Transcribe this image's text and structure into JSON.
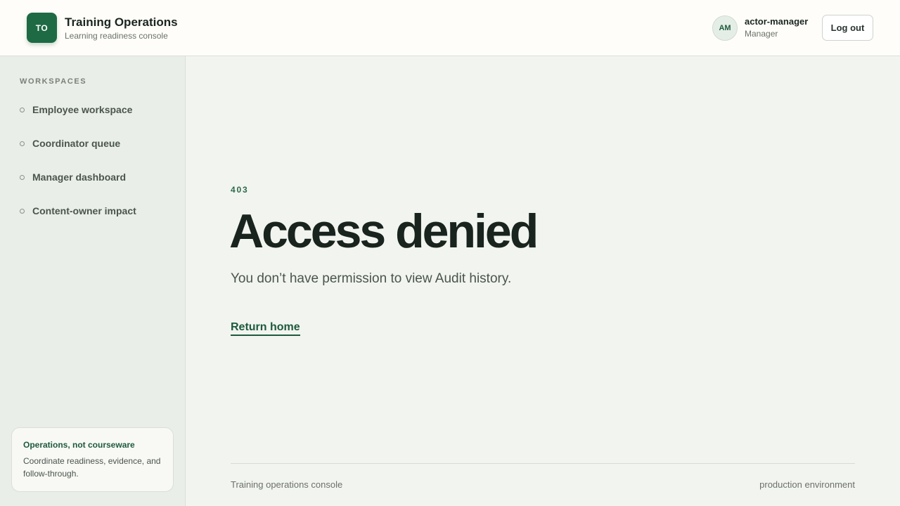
{
  "header": {
    "brand_initials": "TO",
    "brand_title": "Training Operations",
    "brand_subtitle": "Learning readiness console",
    "user_initials": "AM",
    "user_name": "actor-manager",
    "user_role": "Manager",
    "logout_label": "Log out"
  },
  "sidebar": {
    "heading": "WORKSPACES",
    "items": [
      {
        "label": "Employee workspace"
      },
      {
        "label": "Coordinator queue"
      },
      {
        "label": "Manager dashboard"
      },
      {
        "label": "Content-owner impact"
      }
    ],
    "card": {
      "title": "Operations, not courseware",
      "text": "Coordinate readiness, evidence, and follow-through."
    }
  },
  "main": {
    "code": "403",
    "title": "Access denied",
    "description": "You don’t have permission to view Audit history.",
    "return_label": "Return home"
  },
  "footer": {
    "left": "Training operations console",
    "right": "production environment"
  },
  "colors": {
    "accent": "#1e6a45",
    "background": "#f2f4f0",
    "sidebar": "#e9eee8"
  }
}
